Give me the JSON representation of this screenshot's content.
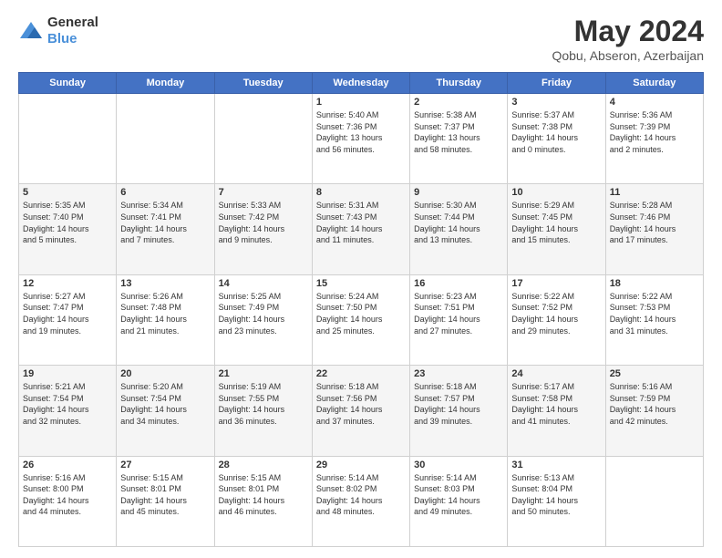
{
  "header": {
    "logo_line1": "General",
    "logo_line2": "Blue",
    "title": "May 2024",
    "subtitle": "Qobu, Abseron, Azerbaijan"
  },
  "days_of_week": [
    "Sunday",
    "Monday",
    "Tuesday",
    "Wednesday",
    "Thursday",
    "Friday",
    "Saturday"
  ],
  "weeks": [
    [
      {
        "day": "",
        "info": ""
      },
      {
        "day": "",
        "info": ""
      },
      {
        "day": "",
        "info": ""
      },
      {
        "day": "1",
        "info": "Sunrise: 5:40 AM\nSunset: 7:36 PM\nDaylight: 13 hours\nand 56 minutes."
      },
      {
        "day": "2",
        "info": "Sunrise: 5:38 AM\nSunset: 7:37 PM\nDaylight: 13 hours\nand 58 minutes."
      },
      {
        "day": "3",
        "info": "Sunrise: 5:37 AM\nSunset: 7:38 PM\nDaylight: 14 hours\nand 0 minutes."
      },
      {
        "day": "4",
        "info": "Sunrise: 5:36 AM\nSunset: 7:39 PM\nDaylight: 14 hours\nand 2 minutes."
      }
    ],
    [
      {
        "day": "5",
        "info": "Sunrise: 5:35 AM\nSunset: 7:40 PM\nDaylight: 14 hours\nand 5 minutes."
      },
      {
        "day": "6",
        "info": "Sunrise: 5:34 AM\nSunset: 7:41 PM\nDaylight: 14 hours\nand 7 minutes."
      },
      {
        "day": "7",
        "info": "Sunrise: 5:33 AM\nSunset: 7:42 PM\nDaylight: 14 hours\nand 9 minutes."
      },
      {
        "day": "8",
        "info": "Sunrise: 5:31 AM\nSunset: 7:43 PM\nDaylight: 14 hours\nand 11 minutes."
      },
      {
        "day": "9",
        "info": "Sunrise: 5:30 AM\nSunset: 7:44 PM\nDaylight: 14 hours\nand 13 minutes."
      },
      {
        "day": "10",
        "info": "Sunrise: 5:29 AM\nSunset: 7:45 PM\nDaylight: 14 hours\nand 15 minutes."
      },
      {
        "day": "11",
        "info": "Sunrise: 5:28 AM\nSunset: 7:46 PM\nDaylight: 14 hours\nand 17 minutes."
      }
    ],
    [
      {
        "day": "12",
        "info": "Sunrise: 5:27 AM\nSunset: 7:47 PM\nDaylight: 14 hours\nand 19 minutes."
      },
      {
        "day": "13",
        "info": "Sunrise: 5:26 AM\nSunset: 7:48 PM\nDaylight: 14 hours\nand 21 minutes."
      },
      {
        "day": "14",
        "info": "Sunrise: 5:25 AM\nSunset: 7:49 PM\nDaylight: 14 hours\nand 23 minutes."
      },
      {
        "day": "15",
        "info": "Sunrise: 5:24 AM\nSunset: 7:50 PM\nDaylight: 14 hours\nand 25 minutes."
      },
      {
        "day": "16",
        "info": "Sunrise: 5:23 AM\nSunset: 7:51 PM\nDaylight: 14 hours\nand 27 minutes."
      },
      {
        "day": "17",
        "info": "Sunrise: 5:22 AM\nSunset: 7:52 PM\nDaylight: 14 hours\nand 29 minutes."
      },
      {
        "day": "18",
        "info": "Sunrise: 5:22 AM\nSunset: 7:53 PM\nDaylight: 14 hours\nand 31 minutes."
      }
    ],
    [
      {
        "day": "19",
        "info": "Sunrise: 5:21 AM\nSunset: 7:54 PM\nDaylight: 14 hours\nand 32 minutes."
      },
      {
        "day": "20",
        "info": "Sunrise: 5:20 AM\nSunset: 7:54 PM\nDaylight: 14 hours\nand 34 minutes."
      },
      {
        "day": "21",
        "info": "Sunrise: 5:19 AM\nSunset: 7:55 PM\nDaylight: 14 hours\nand 36 minutes."
      },
      {
        "day": "22",
        "info": "Sunrise: 5:18 AM\nSunset: 7:56 PM\nDaylight: 14 hours\nand 37 minutes."
      },
      {
        "day": "23",
        "info": "Sunrise: 5:18 AM\nSunset: 7:57 PM\nDaylight: 14 hours\nand 39 minutes."
      },
      {
        "day": "24",
        "info": "Sunrise: 5:17 AM\nSunset: 7:58 PM\nDaylight: 14 hours\nand 41 minutes."
      },
      {
        "day": "25",
        "info": "Sunrise: 5:16 AM\nSunset: 7:59 PM\nDaylight: 14 hours\nand 42 minutes."
      }
    ],
    [
      {
        "day": "26",
        "info": "Sunrise: 5:16 AM\nSunset: 8:00 PM\nDaylight: 14 hours\nand 44 minutes."
      },
      {
        "day": "27",
        "info": "Sunrise: 5:15 AM\nSunset: 8:01 PM\nDaylight: 14 hours\nand 45 minutes."
      },
      {
        "day": "28",
        "info": "Sunrise: 5:15 AM\nSunset: 8:01 PM\nDaylight: 14 hours\nand 46 minutes."
      },
      {
        "day": "29",
        "info": "Sunrise: 5:14 AM\nSunset: 8:02 PM\nDaylight: 14 hours\nand 48 minutes."
      },
      {
        "day": "30",
        "info": "Sunrise: 5:14 AM\nSunset: 8:03 PM\nDaylight: 14 hours\nand 49 minutes."
      },
      {
        "day": "31",
        "info": "Sunrise: 5:13 AM\nSunset: 8:04 PM\nDaylight: 14 hours\nand 50 minutes."
      },
      {
        "day": "",
        "info": ""
      }
    ]
  ]
}
